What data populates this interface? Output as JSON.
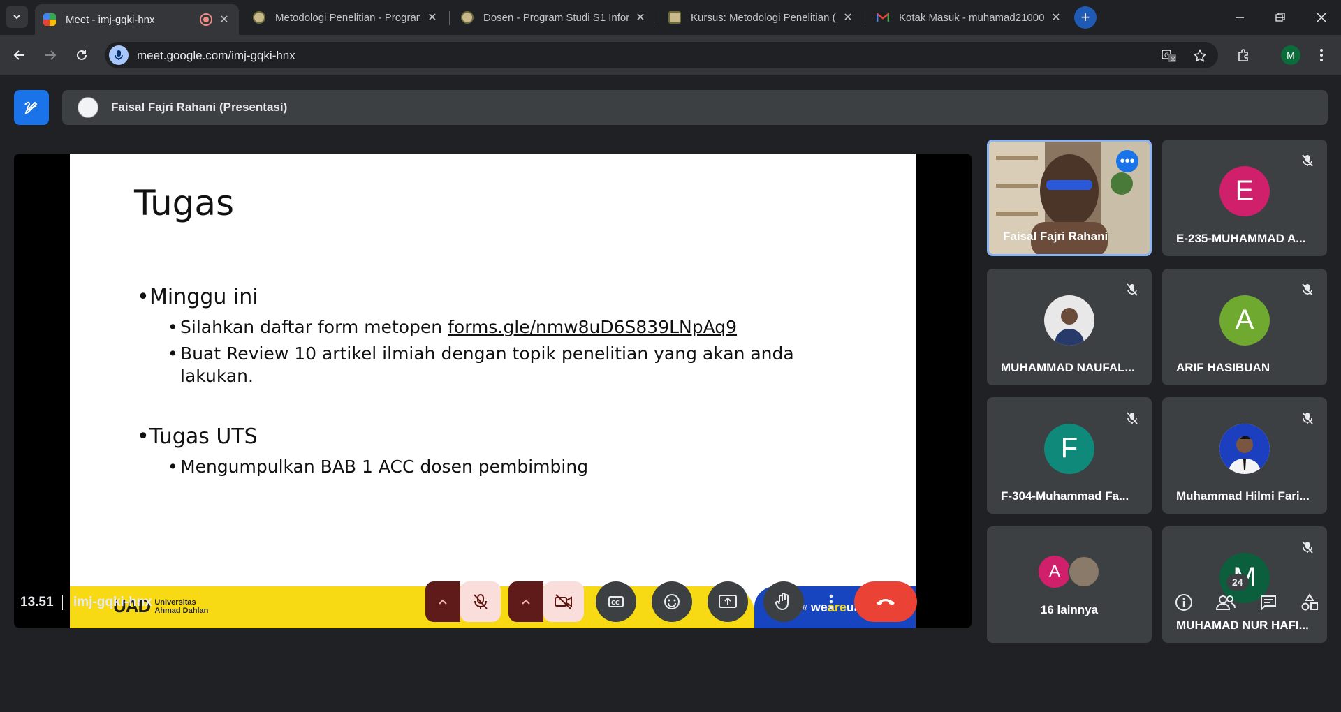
{
  "browser": {
    "tabs": [
      {
        "title": "Meet - imj-gqki-hnx",
        "active": true,
        "favicon": "meet-icon",
        "recording": true
      },
      {
        "title": "Metodologi Penelitian - Program",
        "active": false,
        "favicon": "university-icon"
      },
      {
        "title": "Dosen - Program Studi S1 Inform",
        "active": false,
        "favicon": "university-icon"
      },
      {
        "title": "Kursus: Metodologi Penelitian (I",
        "active": false,
        "favicon": "university-icon"
      },
      {
        "title": "Kotak Masuk - muhamad21000",
        "active": false,
        "favicon": "gmail-icon"
      }
    ],
    "url": "meet.google.com/imj-gqki-hnx",
    "profile_initial": "M"
  },
  "meet": {
    "presenter_label": "Faisal Fajri Rahani (Presentasi)",
    "slide": {
      "title": "Tugas",
      "sections": [
        {
          "heading": "Minggu ini",
          "items": [
            {
              "text": "Silahkan daftar form metopen ",
              "link": "forms.gle/nmw8uD6S839LNpAq9"
            },
            {
              "text": "Buat Review 10 artikel ilmiah dengan topik penelitian yang akan anda",
              "cont": "lakukan."
            }
          ]
        },
        {
          "heading": "Tugas UTS",
          "items": [
            {
              "text": "Mengumpulkan BAB 1 ACC dosen pembimbing"
            }
          ]
        }
      ],
      "footer_brand": "UAD",
      "footer_brand_sub1": "Universitas",
      "footer_brand_sub2": "Ahmad Dahlan",
      "footer_tag_hash": "#",
      "footer_tag_we": "we",
      "footer_tag_are": "are",
      "footer_tag_uad": "uad"
    },
    "participants": [
      {
        "name": "Faisal Fajri Rahani",
        "type": "video",
        "speaking": true
      },
      {
        "name": "E-235-MUHAMMAD A...",
        "initial": "E",
        "color": "#d01f6b",
        "muted": true
      },
      {
        "name": "MUHAMMAD NAUFAL...",
        "type": "photo",
        "muted": true
      },
      {
        "name": "ARIF HASIBUAN",
        "initial": "A",
        "color": "#6fa92f",
        "muted": true
      },
      {
        "name": "F-304-Muhammad Fa...",
        "initial": "F",
        "color": "#0f8a7a",
        "muted": true
      },
      {
        "name": "Muhammad Hilmi Fari...",
        "type": "photo",
        "muted": true
      },
      {
        "name": "16 lainnya",
        "type": "others",
        "initial": "A",
        "color": "#d01f6b"
      },
      {
        "name": "MUHAMAD NUR HAFI...",
        "initial": "M",
        "color": "#0b5f3c",
        "muted": true
      }
    ],
    "time": "13.51",
    "meeting_code": "imj-gqki-hnx",
    "participant_count": "24"
  }
}
